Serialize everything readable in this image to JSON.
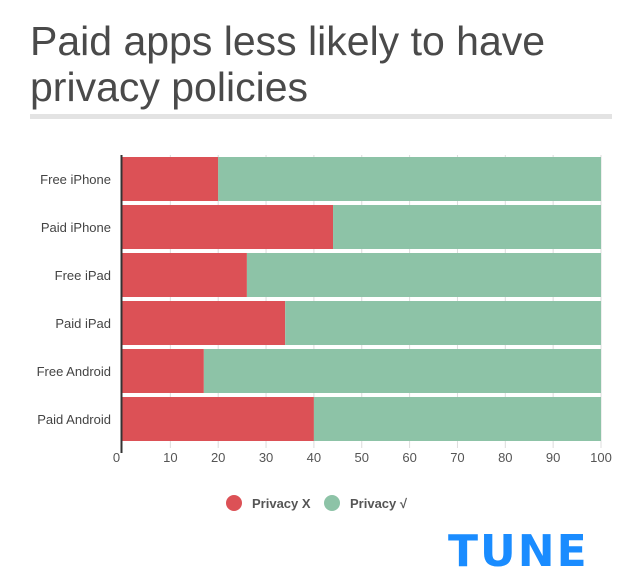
{
  "title": "Paid apps less likely to have privacy policies",
  "logo": "TUNE",
  "chart_data": {
    "type": "bar",
    "orientation": "horizontal",
    "stacked": true,
    "title": "Paid apps less likely to have privacy policies",
    "categories": [
      "Free iPhone",
      "Paid iPhone",
      "Free iPad",
      "Paid iPad",
      "Free Android",
      "Paid Android"
    ],
    "series": [
      {
        "name": "Privacy X",
        "color": "#dc5156",
        "values": [
          20,
          44,
          26,
          34,
          17,
          40
        ]
      },
      {
        "name": "Privacy √",
        "color": "#8dc3a7",
        "values": [
          80,
          56,
          74,
          66,
          83,
          60
        ]
      }
    ],
    "xlim": [
      0,
      100
    ],
    "xticks": [
      0,
      10,
      20,
      30,
      40,
      50,
      60,
      70,
      80,
      90,
      100
    ],
    "grid": true,
    "legend": "bottom"
  }
}
